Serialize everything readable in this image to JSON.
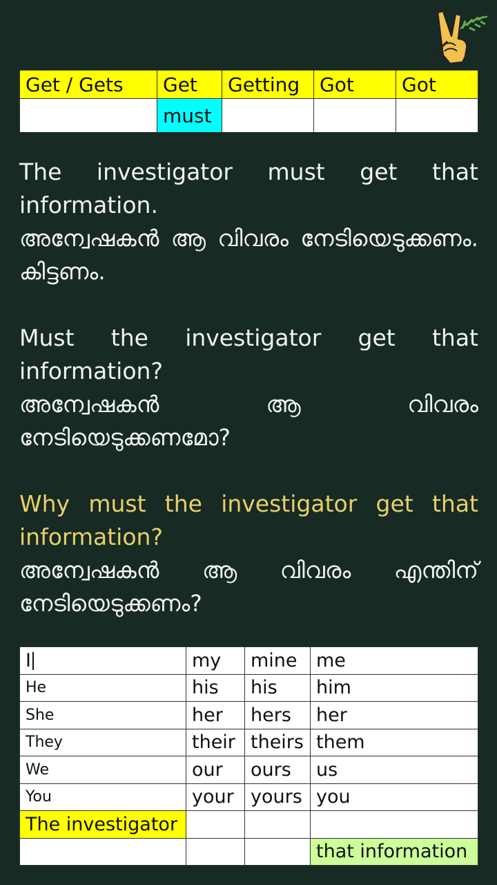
{
  "logo": {
    "icon": "victory-hand-icon",
    "colors": {
      "hand": "#f2c14e",
      "outline": "#222222",
      "leaf": "#6aa84f"
    }
  },
  "colors": {
    "background": "#172a23",
    "text": "#f2f2f2",
    "question_highlight": "#e8d06a",
    "yellow": "#ffff00",
    "cyan": "#00ffff",
    "light_green": "#ccff99"
  },
  "verb_table": {
    "headers": [
      "Get / Gets",
      "Get",
      "Getting",
      "Got",
      "Got"
    ],
    "row2": [
      "",
      "must",
      "",
      "",
      ""
    ]
  },
  "paragraphs": [
    {
      "english": "The investigator must get that information.",
      "malayalam": "അന്വേഷകൻ ആ വിവരം നേടിയെടുക്കണം. കിട്ടണം."
    },
    {
      "english": "Must the investigator get that information?",
      "malayalam": "അന്വേഷകൻ ആ വിവരം നേടിയെടുക്കണമോ?"
    },
    {
      "english": "Why must the investigator get that information?",
      "malayalam": "അന്വേഷകൻ ആ വിവരം എന്തിന് നേടിയെടുക്കണം?"
    }
  ],
  "pronoun_table": {
    "rows": [
      [
        "I",
        "my",
        "mine",
        "me"
      ],
      [
        "He",
        "his",
        "his",
        "him"
      ],
      [
        "She",
        "her",
        "hers",
        "her"
      ],
      [
        "They",
        "their",
        "theirs",
        "them"
      ],
      [
        "We",
        "our",
        "ours",
        "us"
      ],
      [
        "You",
        "your",
        "yours",
        "you"
      ],
      [
        "The investigator",
        "",
        "",
        ""
      ],
      [
        "",
        "",
        "",
        "that information"
      ]
    ]
  }
}
